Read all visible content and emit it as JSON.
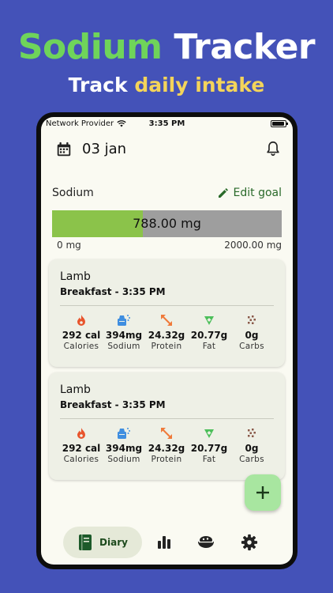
{
  "promo": {
    "title_word1": "Sodium",
    "title_word2": "Tracker",
    "subtitle_word1": "Track",
    "subtitle_word2": "daily intake"
  },
  "status_bar": {
    "carrier": "Network Provider",
    "time": "3:35 PM"
  },
  "header": {
    "date": "03 jan"
  },
  "summary": {
    "label": "Sodium",
    "edit_goal": "Edit goal",
    "current_text": "788.00 mg",
    "min_text": "0 mg",
    "max_text": "2000.00 mg",
    "progress_fraction": 0.394
  },
  "entries": [
    {
      "name": "Lamb",
      "meal": "Breakfast - 3:35 PM",
      "nutrients": [
        {
          "value": "292 cal",
          "label": "Calories",
          "icon": "flame-icon"
        },
        {
          "value": "394mg",
          "label": "Sodium",
          "icon": "salt-shaker-icon"
        },
        {
          "value": "24.32g",
          "label": "Protein",
          "icon": "arrows-diagonal-icon"
        },
        {
          "value": "20.77g",
          "label": "Fat",
          "icon": "drop-icon"
        },
        {
          "value": "0g",
          "label": "Carbs",
          "icon": "grain-icon"
        }
      ]
    },
    {
      "name": "Lamb",
      "meal": "Breakfast - 3:35 PM",
      "nutrients": [
        {
          "value": "292 cal",
          "label": "Calories",
          "icon": "flame-icon"
        },
        {
          "value": "394mg",
          "label": "Sodium",
          "icon": "salt-shaker-icon"
        },
        {
          "value": "24.32g",
          "label": "Protein",
          "icon": "arrows-diagonal-icon"
        },
        {
          "value": "20.77g",
          "label": "Fat",
          "icon": "drop-icon"
        },
        {
          "value": "0g",
          "label": "Carbs",
          "icon": "grain-icon"
        }
      ]
    }
  ],
  "nav": {
    "diary_label": "Diary",
    "items": [
      "diary-icon",
      "stats-icon",
      "bowl-icon",
      "settings-icon"
    ]
  },
  "colors": {
    "background": "#4452b8",
    "title_green": "#6fd45a",
    "subtitle_yellow": "#f4d45a",
    "progress_fill": "#8bc34a",
    "progress_track": "#9e9e9e",
    "fab": "#a8e6a0",
    "calories": "#e8542c",
    "sodium": "#3f8ee0",
    "protein": "#ef7a3a",
    "fat": "#4cbf5a",
    "carbs": "#8a5a4a"
  }
}
